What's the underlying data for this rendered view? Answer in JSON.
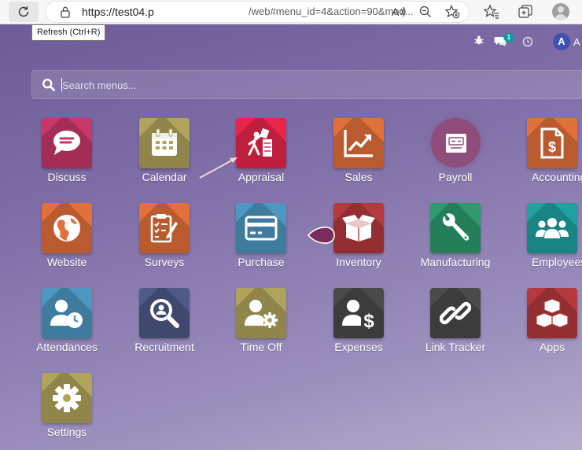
{
  "browser": {
    "refresh_tooltip": "Refresh (Ctrl+R)",
    "url_host": "https://test04.p",
    "url_path": "/web#menu_id=4&action=90&mod..."
  },
  "navbar": {
    "chat_badge_count": "1",
    "user_initial": "A",
    "user_name": "A"
  },
  "search": {
    "placeholder": "Search menus..."
  },
  "apps": [
    {
      "label": "Discuss",
      "icon": "chat-bubble-icon",
      "color": "#c8376a"
    },
    {
      "label": "Calendar",
      "icon": "calendar-icon",
      "color": "#b0a45c"
    },
    {
      "label": "Appraisal",
      "icon": "appraisal-icon",
      "color": "#e8264b"
    },
    {
      "label": "Sales",
      "icon": "chart-up-icon",
      "color": "#e2703a"
    },
    {
      "label": "Payroll",
      "icon": "payroll-icon",
      "color": "#8e4d7b"
    },
    {
      "label": "Accounting",
      "icon": "invoice-dollar-icon",
      "color": "#e2703a"
    },
    {
      "label": "Website",
      "icon": "globe-icon",
      "color": "#e2703a"
    },
    {
      "label": "Surveys",
      "icon": "clipboard-check-icon",
      "color": "#e2703a"
    },
    {
      "label": "Purchase",
      "icon": "credit-card-icon",
      "color": "#4d97c0"
    },
    {
      "label": "Inventory",
      "icon": "box-open-icon",
      "color": "#b43a3e"
    },
    {
      "label": "Manufacturing",
      "icon": "wrench-icon",
      "color": "#2e9a6e"
    },
    {
      "label": "Employees",
      "icon": "users-icon",
      "color": "#20a0a0"
    },
    {
      "label": "Attendances",
      "icon": "user-clock-icon",
      "color": "#4d97c0"
    },
    {
      "label": "Recruitment",
      "icon": "magnifier-icon",
      "color": "#4f5a86"
    },
    {
      "label": "Time Off",
      "icon": "user-gear-icon",
      "color": "#b0a45c"
    },
    {
      "label": "Expenses",
      "icon": "user-dollar-icon",
      "color": "#4a4a4a"
    },
    {
      "label": "Link Tracker",
      "icon": "link-icon",
      "color": "#4a4a4a"
    },
    {
      "label": "Apps",
      "icon": "cubes-icon",
      "color": "#b43a3e"
    },
    {
      "label": "Settings",
      "icon": "gear-icon",
      "color": "#b0a45c"
    }
  ]
}
